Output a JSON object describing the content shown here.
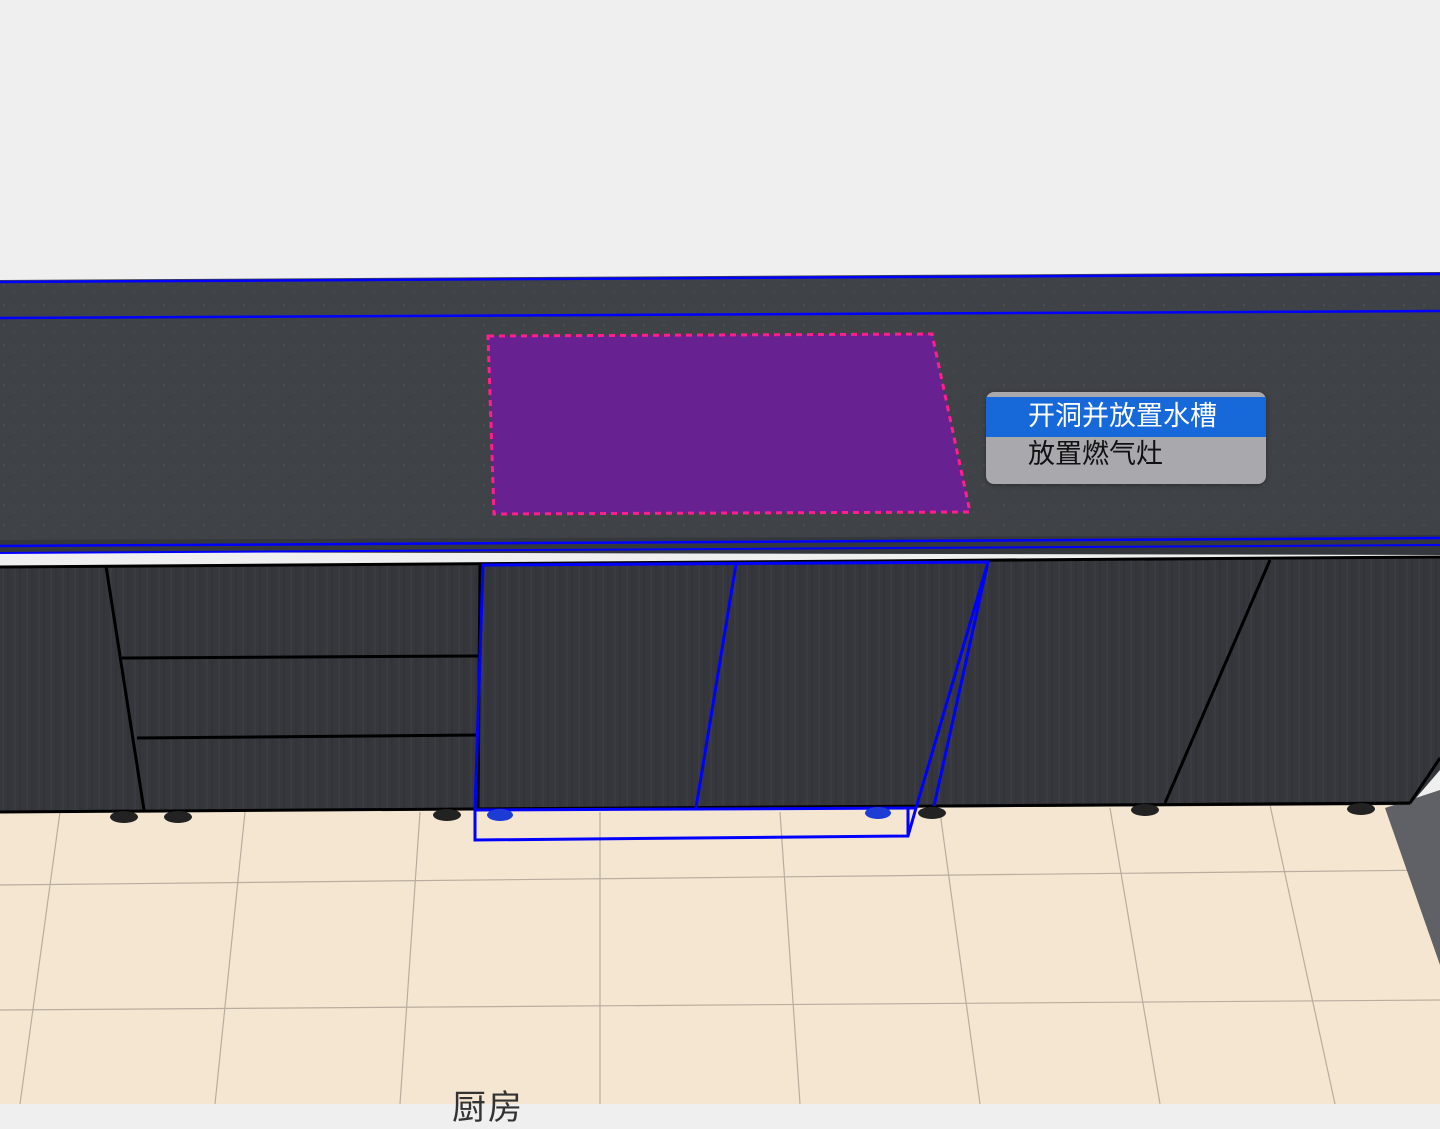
{
  "scene": {
    "room_label": "厨房",
    "colors": {
      "background": "#efefef",
      "countertop": "#3e4145",
      "cabinet": "#35373c",
      "floor": "#f5e6d2",
      "highlight_region": "#6a1e98",
      "highlight_border": "#ff1f8c",
      "selection_outline": "#0000ff"
    }
  },
  "context_menu": {
    "items": [
      {
        "label": "开洞并放置水槽",
        "selected": true
      },
      {
        "label": "放置燃气灶",
        "selected": false
      }
    ],
    "highlight_color": "#1768d9",
    "background_color": "#a8a8ad"
  }
}
